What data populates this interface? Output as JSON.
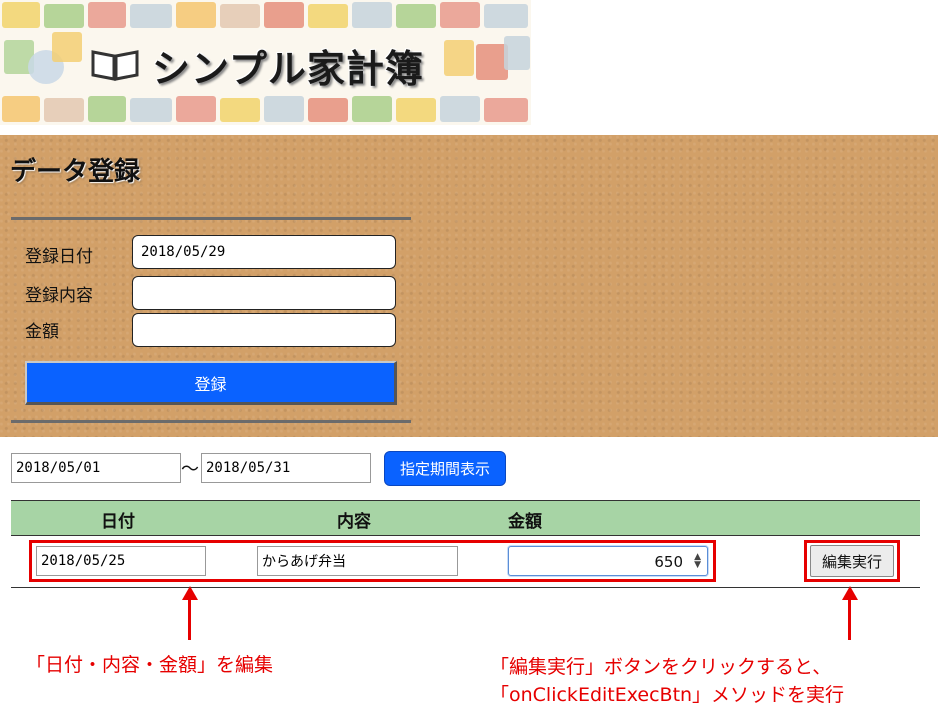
{
  "banner": {
    "title": "シンプル家計簿"
  },
  "registration": {
    "heading": "データ登録",
    "date_label": "登録日付",
    "date_value": "2018/05/29",
    "content_label": "登録内容",
    "content_value": "",
    "amount_label": "金額",
    "amount_value": "",
    "submit_label": "登録"
  },
  "period": {
    "from": "2018/05/01",
    "separator": "〜",
    "to": "2018/05/31",
    "show_button": "指定期間表示"
  },
  "table": {
    "headers": [
      "日付",
      "内容",
      "金額"
    ],
    "rows": [
      {
        "date": "2018/05/25",
        "content": "からあげ弁当",
        "amount": "650",
        "action_label": "編集実行"
      }
    ]
  },
  "annotations": {
    "edit_fields": "「日付・内容・金額」を編集",
    "click_line1": "「編集実行」ボタンをクリックすると、",
    "click_line2": "「onClickEditExecBtn」メソッドを実行"
  },
  "colors": {
    "accent_blue": "#0a62ff",
    "cork": "#d2a068",
    "table_header": "#a7d4a5",
    "annotation_red": "#e60000"
  }
}
